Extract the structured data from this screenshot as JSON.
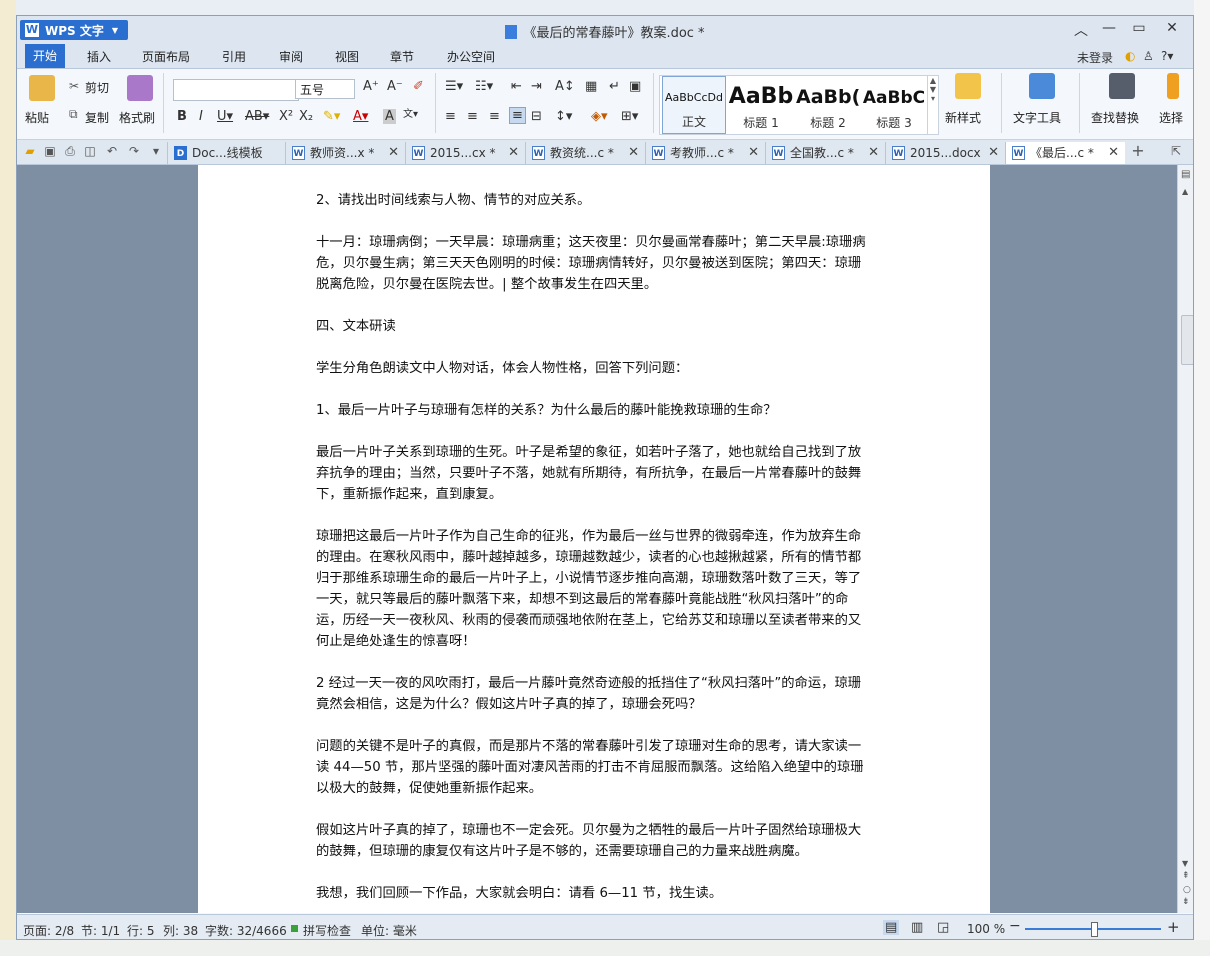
{
  "window": {
    "app_name": "WPS 文字",
    "title": "《最后的常春藤叶》教案.doc *"
  },
  "menu": {
    "tabs": [
      "开始",
      "插入",
      "页面布局",
      "引用",
      "审阅",
      "视图",
      "章节",
      "办公空间"
    ],
    "login": "未登录"
  },
  "ribbon": {
    "paste": "粘贴",
    "cut": "剪切",
    "copy": "复制",
    "format_painter": "格式刷",
    "font_name": "",
    "font_size": "五号",
    "styles": [
      {
        "preview": "AaBbCcDd",
        "label": "正文"
      },
      {
        "preview": "AaBb",
        "label": "标题 1"
      },
      {
        "preview": "AaBb(",
        "label": "标题 2"
      },
      {
        "preview": "AaBbC",
        "label": "标题 3"
      }
    ],
    "new_style": "新样式",
    "text_tools": "文字工具",
    "find_replace": "查找替换",
    "select": "选择"
  },
  "doc_tabs": [
    {
      "label": "Doc...线模板",
      "closable": true
    },
    {
      "label": "教师资...x *",
      "closable": true
    },
    {
      "label": "2015...cx *",
      "closable": true
    },
    {
      "label": "教资统...c *",
      "closable": true
    },
    {
      "label": "考教师...c *",
      "closable": true
    },
    {
      "label": "全国教...c *",
      "closable": true
    },
    {
      "label": "2015...docx",
      "closable": true
    },
    {
      "label": "《最后...c *",
      "closable": true,
      "active": true
    }
  ],
  "document": {
    "paragraphs": [
      "2、请找出时间线索与人物、情节的对应关系。",
      "十一月：琼珊病倒；一天早晨：琼珊病重；这天夜里：贝尔曼画常春藤叶；第二天早晨:琼珊病危，贝尔曼生病；第三天天色刚明的时候：琼珊病情转好，贝尔曼被送到医院；第四天：琼珊脱离危险，贝尔曼在医院去世。| 整个故事发生在四天里。",
      "四、文本研读",
      "学生分角色朗读文中人物对话，体会人物性格，回答下列问题：",
      "1、最后一片叶子与琼珊有怎样的关系？为什么最后的藤叶能挽救琼珊的生命？",
      "最后一片叶子关系到琼珊的生死。叶子是希望的象征，如若叶子落了，她也就给自己找到了放弃抗争的理由；当然，只要叶子不落，她就有所期待，有所抗争，在最后一片常春藤叶的鼓舞下，重新振作起来，直到康复。",
      "琼珊把这最后一片叶子作为自己生命的征兆，作为最后一丝与世界的微弱牵连，作为放弃生命的理由。在寒秋风雨中，藤叶越掉越多，琼珊越数越少，读者的心也越揪越紧，所有的情节都归于那维系琼珊生命的最后一片叶子上，小说情节逐步推向高潮，琼珊数落叶数了三天，等了一天，就只等最后的藤叶飘落下来，却想不到这最后的常春藤叶竟能战胜“秋风扫落叶”的命运，历经一天一夜秋风、秋雨的侵袭而顽强地依附在茎上，它给苏艾和琼珊以至读者带来的又何止是绝处逢生的惊喜呀！",
      "2 经过一天一夜的风吹雨打，最后一片藤叶竟然奇迹般的抵挡住了“秋风扫落叶”的命运，琼珊竟然会相信，这是为什么？假如这片叶子真的掉了，琼珊会死吗？",
      "问题的关键不是叶子的真假，而是那片不落的常春藤叶引发了琼珊对生命的思考，请大家读一读 44—50 节，那片坚强的藤叶面对凄风苦雨的打击不肯屈服而飘落。这给陷入绝望中的琼珊以极大的鼓舞，促使她重新振作起来。",
      "假如这片叶子真的掉了，琼珊也不一定会死。贝尔曼为之牺牲的最后一片叶子固然给琼珊极大的鼓舞，但琼珊的康复仅有这片叶子是不够的，还需要琼珊自己的力量来战胜病魔。",
      "我想，我们回顾一下作品，大家就会明白：请看 6—11 节，找生读。"
    ]
  },
  "status": {
    "page": "页面: 2/8",
    "section": "节: 1/1",
    "row": "行: 5",
    "col": "列: 38",
    "words": "字数: 32/4666",
    "spell": "拼写检查",
    "unit": "单位: 毫米",
    "zoom": "100 %"
  },
  "colors": {
    "accent": "#2a6fd0",
    "desk": "#7f8fa3"
  }
}
